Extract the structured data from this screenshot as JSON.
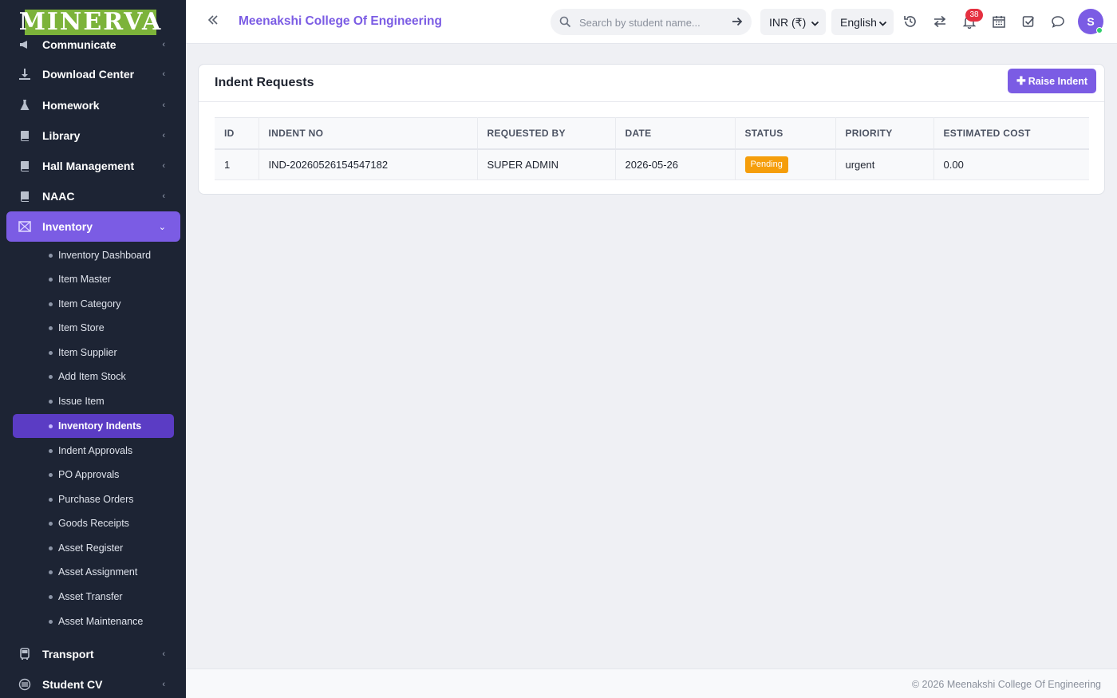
{
  "sidebar": {
    "logo": "MINERVA",
    "items_top": [
      {
        "label": "Communicate",
        "icon": "megaphone-icon"
      },
      {
        "label": "Download Center",
        "icon": "download-icon"
      },
      {
        "label": "Homework",
        "icon": "flask-icon"
      },
      {
        "label": "Library",
        "icon": "book-icon"
      },
      {
        "label": "Hall Management",
        "icon": "book-icon"
      },
      {
        "label": "NAAC",
        "icon": "book-icon"
      }
    ],
    "active_item": {
      "label": "Inventory",
      "icon": "inventory-icon"
    },
    "sub_items": [
      "Inventory Dashboard",
      "Item Master",
      "Item Category",
      "Item Store",
      "Item Supplier",
      "Add Item Stock",
      "Issue Item",
      "Inventory Indents",
      "Indent Approvals",
      "PO Approvals",
      "Purchase Orders",
      "Goods Receipts",
      "Asset Register",
      "Asset Assignment",
      "Asset Transfer",
      "Asset Maintenance"
    ],
    "active_sub": "Inventory Indents",
    "items_bottom": [
      {
        "label": "Transport",
        "icon": "bus-icon"
      },
      {
        "label": "Student CV",
        "icon": "cv-icon"
      }
    ]
  },
  "header": {
    "college_name": "Meenakshi College Of Engineering",
    "search_placeholder": "Search by student name...",
    "currency": "INR (₹)",
    "language": "English",
    "notification_count": "38",
    "avatar_letter": "S"
  },
  "card": {
    "title": "Indent Requests",
    "raise_button": "Raise Indent",
    "columns": [
      "ID",
      "INDENT NO",
      "REQUESTED BY",
      "DATE",
      "STATUS",
      "PRIORITY",
      "ESTIMATED COST"
    ],
    "rows": [
      {
        "id": "1",
        "indent_no": "IND-20260526154547182",
        "requested_by": "SUPER ADMIN",
        "date": "2026-05-26",
        "status": "Pending",
        "priority": "urgent",
        "cost": "0.00"
      }
    ]
  },
  "footer": {
    "text": "© 2026 Meenakshi College Of Engineering"
  },
  "colors": {
    "accent": "#7b5ce4",
    "sidebar_bg": "#1d2434",
    "status_pending": "#f59e0b",
    "logo_bg": "#7cb33a"
  }
}
